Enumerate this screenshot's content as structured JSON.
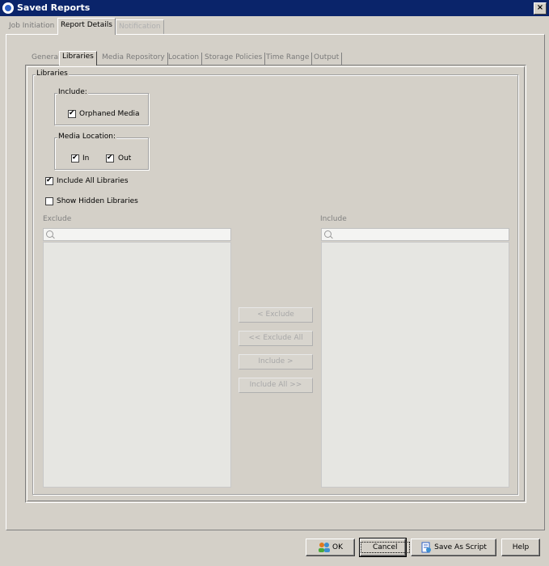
{
  "window": {
    "title": "Saved Reports",
    "close_glyph": "×"
  },
  "outer_tabs": [
    {
      "label": "Job Initiation",
      "state": "inactive"
    },
    {
      "label": "Report Details",
      "state": "active"
    },
    {
      "label": "Notification",
      "state": "disabled"
    }
  ],
  "inner_tabs": [
    {
      "label": "General",
      "state": "inactive"
    },
    {
      "label": "Libraries",
      "state": "active"
    },
    {
      "label": "Media Repository",
      "state": "inactive"
    },
    {
      "label": "Location",
      "state": "inactive"
    },
    {
      "label": "Storage Policies",
      "state": "inactive"
    },
    {
      "label": "Time Range",
      "state": "inactive"
    },
    {
      "label": "Output",
      "state": "inactive"
    }
  ],
  "libraries": {
    "group_title": "Libraries",
    "include_group": {
      "title": "Include:",
      "orphaned_media": {
        "label": "Orphaned Media",
        "checked": true
      }
    },
    "media_location": {
      "title": "Media Location:",
      "in": {
        "label": "In",
        "checked": true
      },
      "out": {
        "label": "Out",
        "checked": true
      }
    },
    "include_all": {
      "label": "Include All Libraries",
      "checked": true
    },
    "show_hidden": {
      "label": "Show Hidden Libraries",
      "checked": false
    },
    "exclude_label": "Exclude",
    "include_label": "Include",
    "buttons": {
      "exclude": "< Exclude",
      "exclude_all": "<< Exclude All",
      "include": "Include >",
      "include_all": "Include All >>"
    }
  },
  "footer": {
    "ok": "OK",
    "cancel": "Cancel",
    "save_as_script": "Save As Script",
    "help": "Help"
  },
  "icons": {
    "search": "search-icon",
    "ok": "users-icon",
    "script": "script-icon"
  }
}
